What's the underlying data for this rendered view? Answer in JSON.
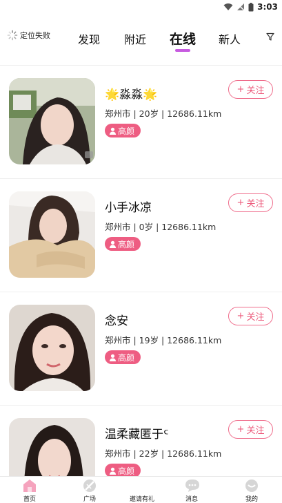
{
  "status_bar": {
    "time": "3:03",
    "icons": [
      "wifi-icon",
      "signal-icon",
      "battery-icon"
    ]
  },
  "top_nav": {
    "location_label": "定位失败",
    "tabs": [
      {
        "label": "发现",
        "active": false
      },
      {
        "label": "附近",
        "active": false
      },
      {
        "label": "在线",
        "active": true
      },
      {
        "label": "新人",
        "active": false
      }
    ],
    "filter_icon": "filter-icon",
    "accent_color": "#c75be0"
  },
  "users": [
    {
      "name": "🌟淼淼🌟",
      "meta": "郑州市 | 20岁 | 12686.11km",
      "badge": "高颜",
      "follow_label": "关注"
    },
    {
      "name": "小手冰凉",
      "meta": "郑州市 | 0岁 | 12686.11km",
      "badge": "高颜",
      "follow_label": "关注"
    },
    {
      "name": "念安",
      "meta": "郑州市 | 19岁 | 12686.11km",
      "badge": "高颜",
      "follow_label": "关注"
    },
    {
      "name": "温柔藏匿于ᑦ",
      "meta": "郑州市 | 22岁 | 12686.11km",
      "badge": "高颜",
      "follow_label": "关注"
    }
  ],
  "bottom_nav": [
    {
      "label": "首页",
      "icon": "home-icon",
      "active": true
    },
    {
      "label": "广场",
      "icon": "plaza-icon",
      "active": false
    },
    {
      "label": "邀请有礼",
      "icon": "gift-icon",
      "active": false
    },
    {
      "label": "消息",
      "icon": "message-icon",
      "active": false
    },
    {
      "label": "我的",
      "icon": "profile-icon",
      "active": false
    }
  ],
  "colors": {
    "badge": "#ee5d82",
    "follow": "#ec5a7b",
    "home_active": "#f5a3bd"
  }
}
